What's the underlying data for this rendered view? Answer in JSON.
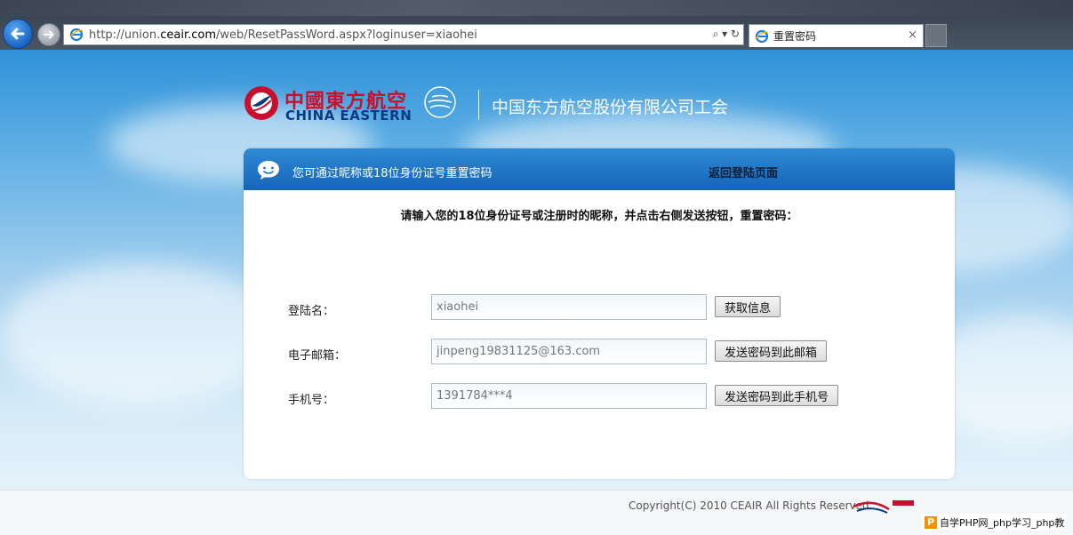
{
  "browser": {
    "url_prefix": "http://union.",
    "url_domain": "ceair.com",
    "url_rest": "/web/ResetPassWord.aspx?loginuser=xiaohei",
    "address_tools": "⌕ ▾ ↻",
    "tab_title": "重置密码",
    "tab_close": "×"
  },
  "header": {
    "logo_cn": "中國東方航空",
    "logo_en": "CHINA EASTERN",
    "union_title": "中国东方航空股份有限公司工会"
  },
  "panel": {
    "title": "您可通过昵称或18位身份证号重置密码",
    "back_link": "返回登陆页面",
    "instruction": "请输入您的18位身份证号或注册时的昵称，并点击右侧发送按钮，重置密码：",
    "fields": [
      {
        "label": "登陆名：",
        "value": "xiaohei",
        "button": "获取信息"
      },
      {
        "label": "电子邮箱：",
        "value": "jinpeng19831125@163.com",
        "button": "发送密码到此邮箱"
      },
      {
        "label": "手机号：",
        "value": "1391784***4",
        "button": "发送密码到此手机号"
      }
    ]
  },
  "footer": {
    "copyright": "Copyright(C) 2010 CEAIR All Rights Reserved.",
    "watermark_badge": "P",
    "watermark_text": "自学PHP网_php学习_php教"
  },
  "colors": {
    "brand_red": "#c8102e",
    "brand_blue": "#0b3a82",
    "header_blue": "#1665b8"
  }
}
